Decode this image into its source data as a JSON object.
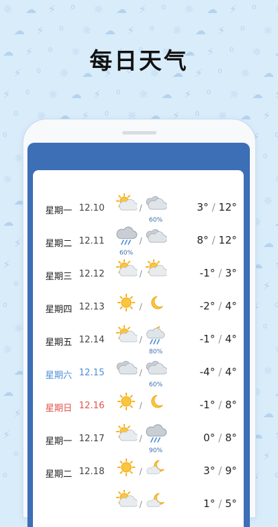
{
  "headline": "每日天气",
  "forecast": [
    {
      "weekday": "星期一",
      "date": "12.10",
      "day_icon": "partly-cloudy-icon",
      "night_icon": "cloudy-icon",
      "day_pop": "",
      "night_pop": "60%",
      "low": "3°",
      "high": "12°",
      "variant": "normal"
    },
    {
      "weekday": "星期二",
      "date": "12.11",
      "day_icon": "rain-icon",
      "night_icon": "cloudy-icon",
      "day_pop": "60%",
      "night_pop": "",
      "low": "8°",
      "high": "12°",
      "variant": "normal"
    },
    {
      "weekday": "星期三",
      "date": "12.12",
      "day_icon": "partly-cloudy-icon",
      "night_icon": "partly-cloudy-icon",
      "day_pop": "",
      "night_pop": "",
      "low": "-1°",
      "high": "3°",
      "variant": "normal"
    },
    {
      "weekday": "星期四",
      "date": "12.13",
      "day_icon": "sunny-icon",
      "night_icon": "moon-icon",
      "day_pop": "",
      "night_pop": "",
      "low": "-2°",
      "high": "4°",
      "variant": "normal"
    },
    {
      "weekday": "星期五",
      "date": "12.14",
      "day_icon": "partly-cloudy-icon",
      "night_icon": "night-rain-icon",
      "day_pop": "",
      "night_pop": "80%",
      "low": "-1°",
      "high": "4°",
      "variant": "normal"
    },
    {
      "weekday": "星期六",
      "date": "12.15",
      "day_icon": "cloudy-icon",
      "night_icon": "cloudy-icon",
      "day_pop": "",
      "night_pop": "60%",
      "low": "-4°",
      "high": "4°",
      "variant": "sat"
    },
    {
      "weekday": "星期日",
      "date": "12.16",
      "day_icon": "sunny-icon",
      "night_icon": "moon-icon",
      "day_pop": "",
      "night_pop": "",
      "low": "-1°",
      "high": "8°",
      "variant": "sun"
    },
    {
      "weekday": "星期一",
      "date": "12.17",
      "day_icon": "partly-cloudy-icon",
      "night_icon": "rain-icon",
      "day_pop": "",
      "night_pop": "90%",
      "low": "0°",
      "high": "8°",
      "variant": "normal"
    },
    {
      "weekday": "星期二",
      "date": "12.18",
      "day_icon": "sunny-icon",
      "night_icon": "moon-cloud-icon",
      "day_pop": "",
      "night_pop": "",
      "low": "3°",
      "high": "9°",
      "variant": "normal"
    },
    {
      "weekday": "",
      "date": "",
      "day_icon": "partly-cloudy-icon",
      "night_icon": "moon-cloud-icon",
      "day_pop": "",
      "night_pop": "",
      "low": "1°",
      "high": "5°",
      "variant": "normal"
    }
  ],
  "colors": {
    "background": "#d9ecfa",
    "frame_blue": "#3d6fb6",
    "saturday": "#4c8fd8",
    "sunday": "#e2524b",
    "precip": "#3b6fae"
  }
}
